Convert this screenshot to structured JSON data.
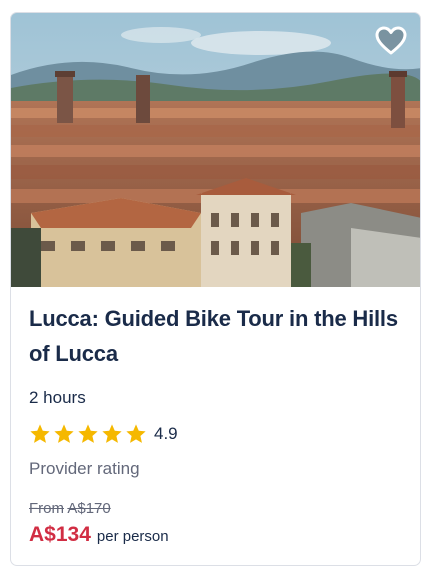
{
  "card": {
    "title": "Lucca: Guided Bike Tour in the Hills of Lucca",
    "duration": "2 hours",
    "rating": {
      "stars_filled": 5,
      "stars_total": 5,
      "score": "4.9"
    },
    "rating_caption": "Provider rating",
    "price": {
      "from_label": "From",
      "original": "A$170",
      "current": "A$134",
      "unit": "per person"
    },
    "colors": {
      "title": "#1a2b49",
      "price": "#d12d43",
      "star": "#f5b800",
      "muted": "#63687a"
    },
    "icons": {
      "wishlist": "heart-icon",
      "rating": "star-icon"
    }
  }
}
